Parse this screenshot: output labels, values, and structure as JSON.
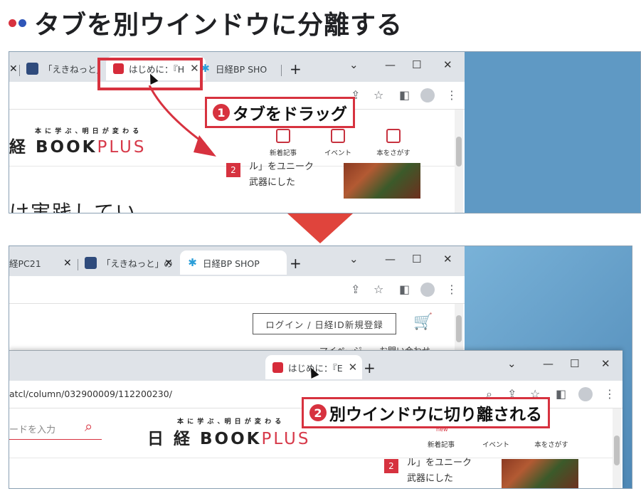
{
  "heading": {
    "title": "タブを別ウインドウに分離する",
    "dot_colors": [
      "#d7323f",
      "#2f56b8"
    ]
  },
  "step1": {
    "tabs": [
      {
        "label": "「えきねっと」(",
        "favicon": "eki-icon"
      },
      {
        "label": "はじめに：『H",
        "favicon": "nikkei-icon"
      },
      {
        "label": "日経BP SHO",
        "favicon": "bp-icon"
      }
    ],
    "new_tab": "+",
    "callout_number": "1",
    "callout_text": "タブをドラッグ",
    "site": {
      "tagline": "本 に 学 ぶ 、明 日 が 変 わ る",
      "brand_bold": "経 BOOK",
      "brand_plus": "PLUS",
      "nav": [
        "新着記事",
        "イベント",
        "本をさがす"
      ],
      "rank": "2",
      "article_line1": "ル」をユニーク",
      "article_line2": "武器にした",
      "big_text": "け実践してい"
    }
  },
  "step2": {
    "back_window": {
      "tabs": [
        {
          "label": "経PC21"
        },
        {
          "label": "「えきねっと」の偽",
          "favicon": "eki-icon"
        },
        {
          "label": "日経BP SHOP",
          "favicon": "bp-icon"
        }
      ],
      "new_tab": "+",
      "login_label": "ログイン / 日経ID新規登録",
      "mypage": "マイページ",
      "contact": "お問い合わせ"
    },
    "front_window": {
      "tab": {
        "label": "はじめに：『E",
        "favicon": "nikkei-icon"
      },
      "new_tab": "+",
      "url": "atcl/column/032900009/112200230/",
      "search_placeholder": "ードを入力",
      "site": {
        "tagline": "本 に 学 ぶ 、明 日 が 変 わ る",
        "brand_bold": "日 経 BOOK",
        "brand_plus": "PLUS",
        "nav": [
          "新着記事",
          "イベント",
          "本をさがす"
        ],
        "new_badge": "new",
        "rank": "2",
        "article_line1": "ル」をユニーク",
        "article_line2": "武器にした"
      }
    },
    "callout_number": "2",
    "callout_text": "別ウインドウに切り離される"
  },
  "colors": {
    "accent": "#d7323f",
    "desktop": "#5f99c4"
  }
}
